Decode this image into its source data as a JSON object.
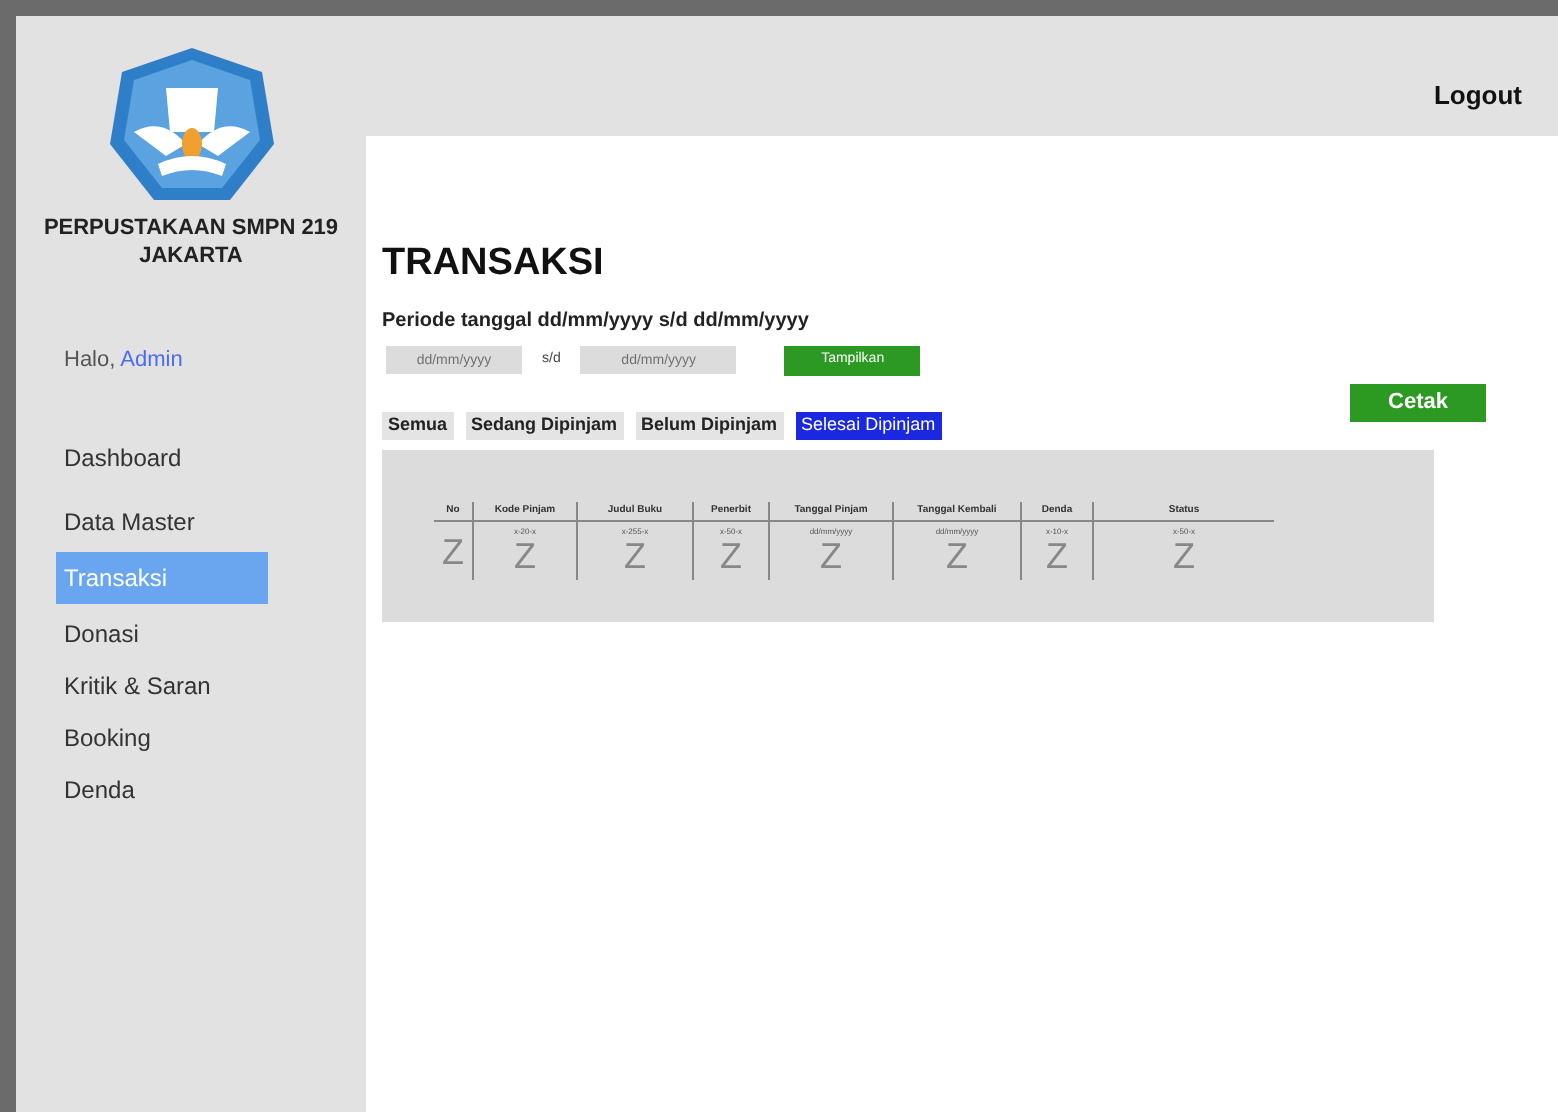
{
  "sidebar": {
    "school_name": "PERPUSTAKAAN SMPN 219 JAKARTA",
    "greeting": "Halo,",
    "user": "Admin",
    "items": [
      {
        "label": "Dashboard",
        "selected": false
      },
      {
        "label": "Data Master",
        "selected": false
      },
      {
        "label": "Transaksi",
        "selected": true
      },
      {
        "label": "Donasi",
        "selected": false
      },
      {
        "label": "Kritik & Saran",
        "selected": false
      },
      {
        "label": "Booking",
        "selected": false
      },
      {
        "label": "Denda",
        "selected": false
      }
    ]
  },
  "header": {
    "logout": "Logout"
  },
  "page_title": "TRANSAKSI",
  "period": {
    "label": "Periode tanggal dd/mm/yyyy s/d dd/mm/yyyy",
    "from_placeholder": "dd/mm/yyyy",
    "separator": "s/d",
    "to_placeholder": "dd/mm/yyyy",
    "show_button": "Tampilkan"
  },
  "filters": [
    {
      "label": "Semua",
      "selected": false
    },
    {
      "label": "Sedang Dipinjam",
      "selected": false
    },
    {
      "label": "Belum Dipinjam",
      "selected": false
    },
    {
      "label": "Selesai Dipinjam",
      "selected": true
    }
  ],
  "print_button": "Cetak",
  "table": {
    "columns": [
      {
        "heading": "No",
        "value": "Z"
      },
      {
        "heading": "Kode Pinjam",
        "hint": "x-20-x",
        "value": "Z"
      },
      {
        "heading": "Judul Buku",
        "hint": "x-255-x",
        "value": "Z"
      },
      {
        "heading": "Penerbit",
        "hint": "x-50-x",
        "value": "Z"
      },
      {
        "heading": "Tanggal Pinjam",
        "hint": "dd/mm/yyyy",
        "value": "Z"
      },
      {
        "heading": "Tanggal Kembali",
        "hint": "dd/mm/yyyy",
        "value": "Z"
      },
      {
        "heading": "Denda",
        "hint": "x-10-x",
        "value": "Z"
      },
      {
        "heading": "Status",
        "hint": "x-50-x",
        "value": "Z"
      }
    ]
  }
}
